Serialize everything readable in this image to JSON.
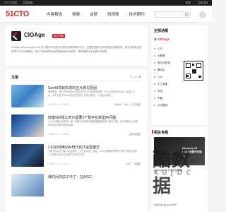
{
  "topbar": {
    "links": [
      "51CTO首页",
      "内容精选"
    ],
    "right": [
      "登录",
      "立即注册"
    ]
  },
  "nav": {
    "logo": "51CTO",
    "items": [
      "内容精选",
      "视频",
      "话题",
      "短视频",
      "技术期刊",
      "活动"
    ]
  },
  "profile": {
    "name": "CIOAge",
    "badge": "专栏作者",
    "desc": "CIOage (www.ciioage.com) 作为国内专业数字化转型领域的服务平台，主要提供数字化转型相关战略咨询、数字化转型实施指导与方法论等服务，致力于推动数字化转型落地和价值实现，帮助和推动企业数字化转型。"
  },
  "articles": {
    "heading": "文章",
    "count": "共 4214 篇",
    "items": [
      {
        "title": "GenAI项目失败的五大常见原因",
        "summary": "根据报告，超过30%的GenAI项目将于2025年底被放弃，CIO应该如何应对这一挑战？为此，我们总结了GenAI项目失败的五大常见原因，以及应对措施。",
        "date": "2025-07-17 17:29:50",
        "tags": [
          "GenAI",
          "CIO",
          "人工智能"
        ]
      },
      {
        "title": "财富500强公司只需要2个数字化转型的问题",
        "summary": "对于大多数公司来说，每一项数字化转型项目都需要回答两个基本问题，这也是其中大多数转型项目失败的根本原因。",
        "date": "2025-07-17 17:28:30",
        "tags": [
          "数字化转型"
        ]
      },
      {
        "title": "CIO如何推动AI时代的IT运营模式",
        "summary": "生成式AI正在改变IT运营模式，为了应对这一变化，CIO们需要重新思考IT部门的组织结构、人才培养以及与业务部门的协作方式。",
        "date": "2025-07-17 17:24:07",
        "tags": [
          "CIO",
          "IT运营"
        ]
      },
      {
        "title": "靠时间向前工作了：在AIGC",
        "summary": "",
        "date": "",
        "tags": []
      }
    ]
  },
  "sidebar": {
    "topics_heading": "全部话题",
    "brand": "CIOAge",
    "topics": [
      "CIO",
      "大数据",
      "数字化转型",
      "腾讯云",
      "CIO",
      "人工智能",
      "安全",
      "专题",
      "AI大模型"
    ],
    "special_heading": "相关专题",
    "banner_text": "Harmony OS NEXT 全景开发指南",
    "rows": [
      "HarmonyOS 开发实战教程",
      "2025-06-04 14:30:59"
    ]
  },
  "watermark": {
    "main": "酷数据",
    "sub": "KUJDC"
  }
}
